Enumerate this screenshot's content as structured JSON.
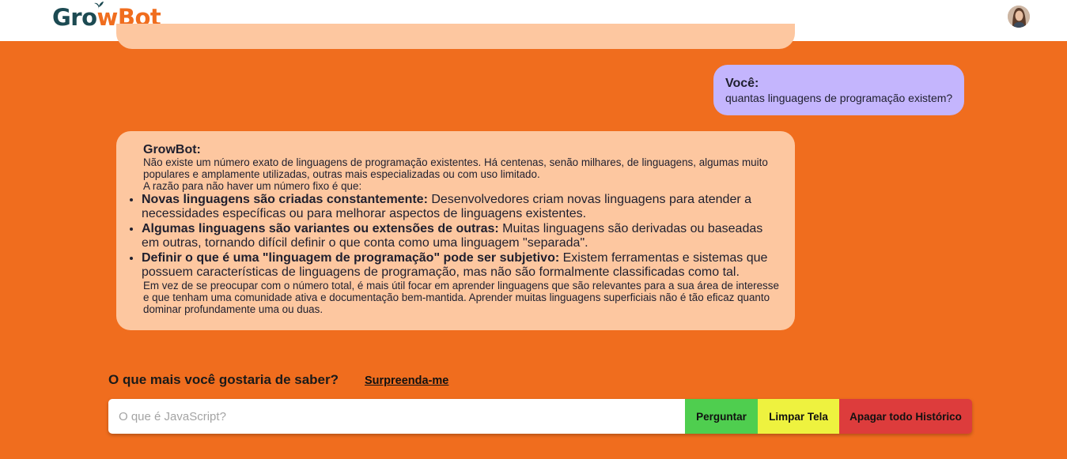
{
  "header": {
    "logo_part1": "Gr",
    "logo_o": "o",
    "logo_part2": "wBot",
    "brand_dark": "#1c4a52",
    "brand_orange": "#f06d1e",
    "avatar_icon": "user-avatar"
  },
  "chat": {
    "user_message": {
      "sender": "Você:",
      "text": "quantas linguagens de programação existem?"
    },
    "bot_message": {
      "sender": "GrowBot:",
      "intro": "Não existe um número exato de linguagens de programação existentes. Há centenas, senão milhares, de linguagens, algumas muito populares e amplamente utilizadas, outras mais especializadas ou com uso limitado.",
      "reason_intro": "A razão para não haver um número fixo é que:",
      "points": [
        {
          "bold": "Novas linguagens são criadas constantemente:",
          "text": " Desenvolvedores criam novas linguagens para atender a necessidades específicas ou para melhorar aspectos de linguagens existentes."
        },
        {
          "bold": "Algumas linguagens são variantes ou extensões de outras:",
          "text": " Muitas linguagens são derivadas ou baseadas em outras, tornando difícil definir o que conta como uma linguagem \"separada\"."
        },
        {
          "bold": "Definir o que é uma \"linguagem de programação\" pode ser subjetivo:",
          "text": " Existem ferramentas e sistemas que possuem características de linguagens de programação, mas não são formalmente classificadas como tal."
        }
      ],
      "conclusion": "Em vez de se preocupar com o número total, é mais útil focar em aprender linguagens que são relevantes para a sua área de interesse e que tenham uma comunidade ativa e documentação bem-mantida. Aprender muitas linguagens superficiais não é tão eficaz quanto dominar profundamente uma ou duas."
    }
  },
  "ask": {
    "question": "O que mais você gostaria de saber?",
    "surprise_link": "Surpreenda-me",
    "placeholder": "O que é JavaScript?",
    "ask_button": "Perguntar",
    "clear_button": "Limpar Tela",
    "delete_button": "Apagar todo Histórico"
  },
  "colors": {
    "background": "#f06d1e",
    "bot_bubble": "#fdc7a0",
    "user_bubble": "#c4b5fd",
    "ask_button": "#4fce4f",
    "clear_button": "#eef23f",
    "delete_button": "#dd3c3c"
  }
}
